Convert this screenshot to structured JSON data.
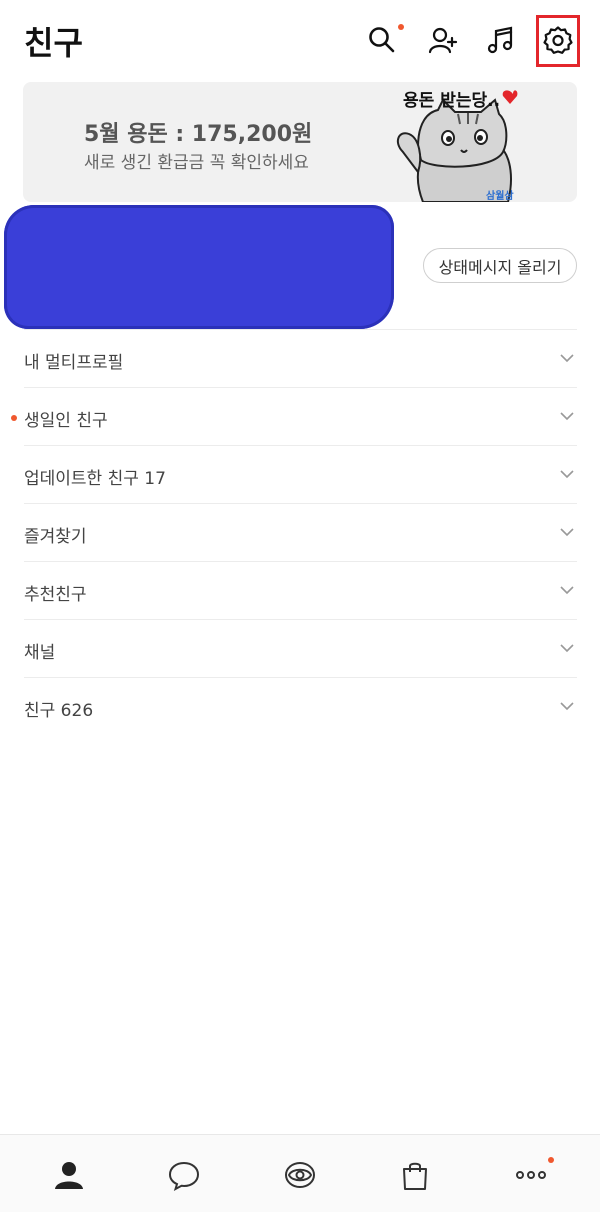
{
  "header": {
    "title": "친구",
    "icons": [
      "search-icon",
      "add-friend-icon",
      "music-icon",
      "settings-icon"
    ]
  },
  "banner": {
    "title": "5월 용돈 : 175,200원",
    "subtitle": "새로 생긴 환급금 꼭 확인하세요",
    "sticker_text": "용돈 받는당..",
    "sticker_brand": "삼월삼"
  },
  "profile": {
    "status_button": "상태메시지 올리기"
  },
  "sections": [
    {
      "label": "내 멀티프로필",
      "dot": false
    },
    {
      "label": "생일인 친구",
      "dot": true
    },
    {
      "label": "업데이트한 친구 17",
      "dot": false
    },
    {
      "label": "즐겨찾기",
      "dot": false
    },
    {
      "label": "추천친구",
      "dot": false
    },
    {
      "label": "채널",
      "dot": false
    },
    {
      "label": "친구 626",
      "dot": false
    }
  ],
  "bottom_nav": [
    "friends-icon",
    "chat-icon",
    "view-icon",
    "shopping-icon",
    "more-icon"
  ],
  "colors": {
    "accent_dot": "#f0582e",
    "highlight_box": "#e3262b",
    "banner_bg": "#f1f1f1"
  }
}
